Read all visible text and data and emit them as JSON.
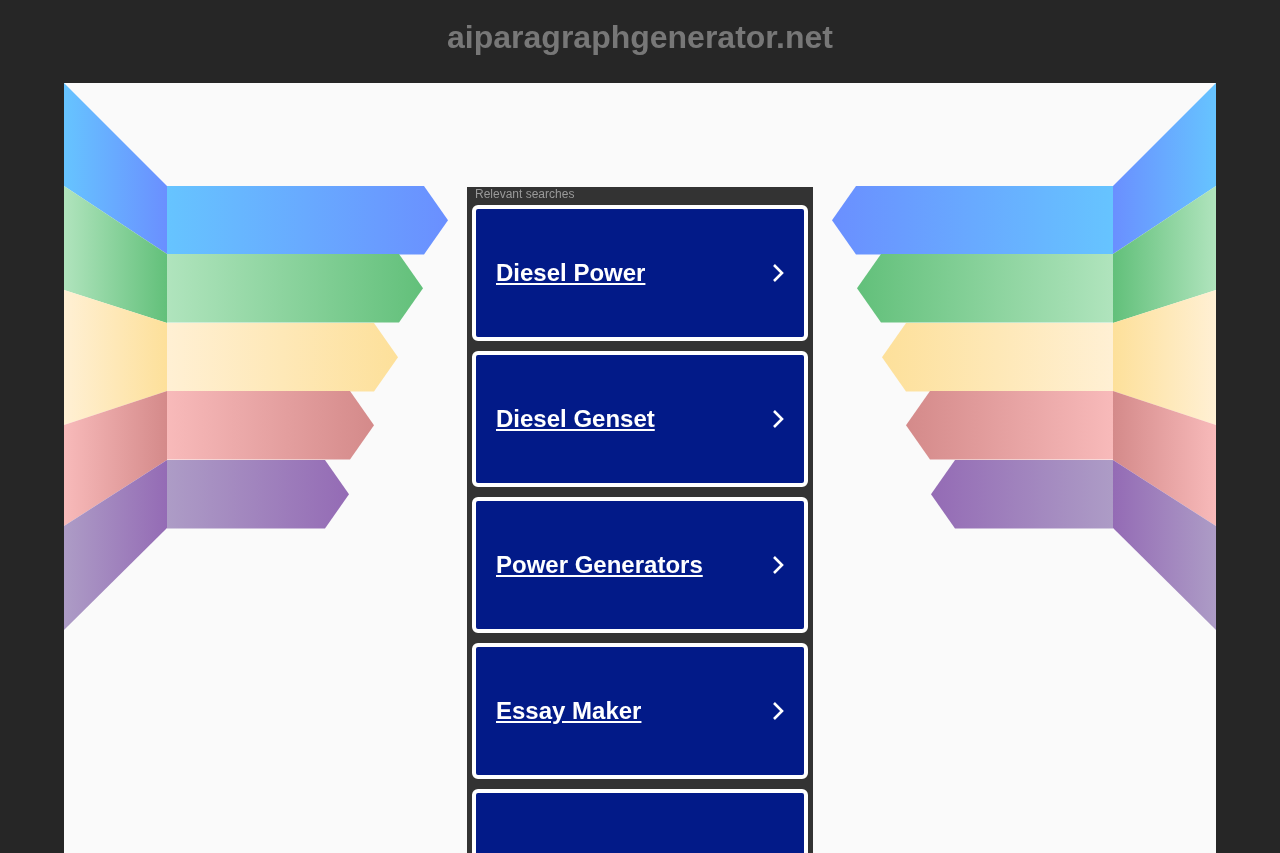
{
  "header": {
    "domain": "aiparagraphgenerator.net"
  },
  "related": {
    "title": "Relevant searches",
    "searches": [
      {
        "label": "Diesel Power"
      },
      {
        "label": "Diesel Genset"
      },
      {
        "label": "Power Generators"
      },
      {
        "label": "Essay Maker"
      }
    ],
    "more_below": true
  }
}
